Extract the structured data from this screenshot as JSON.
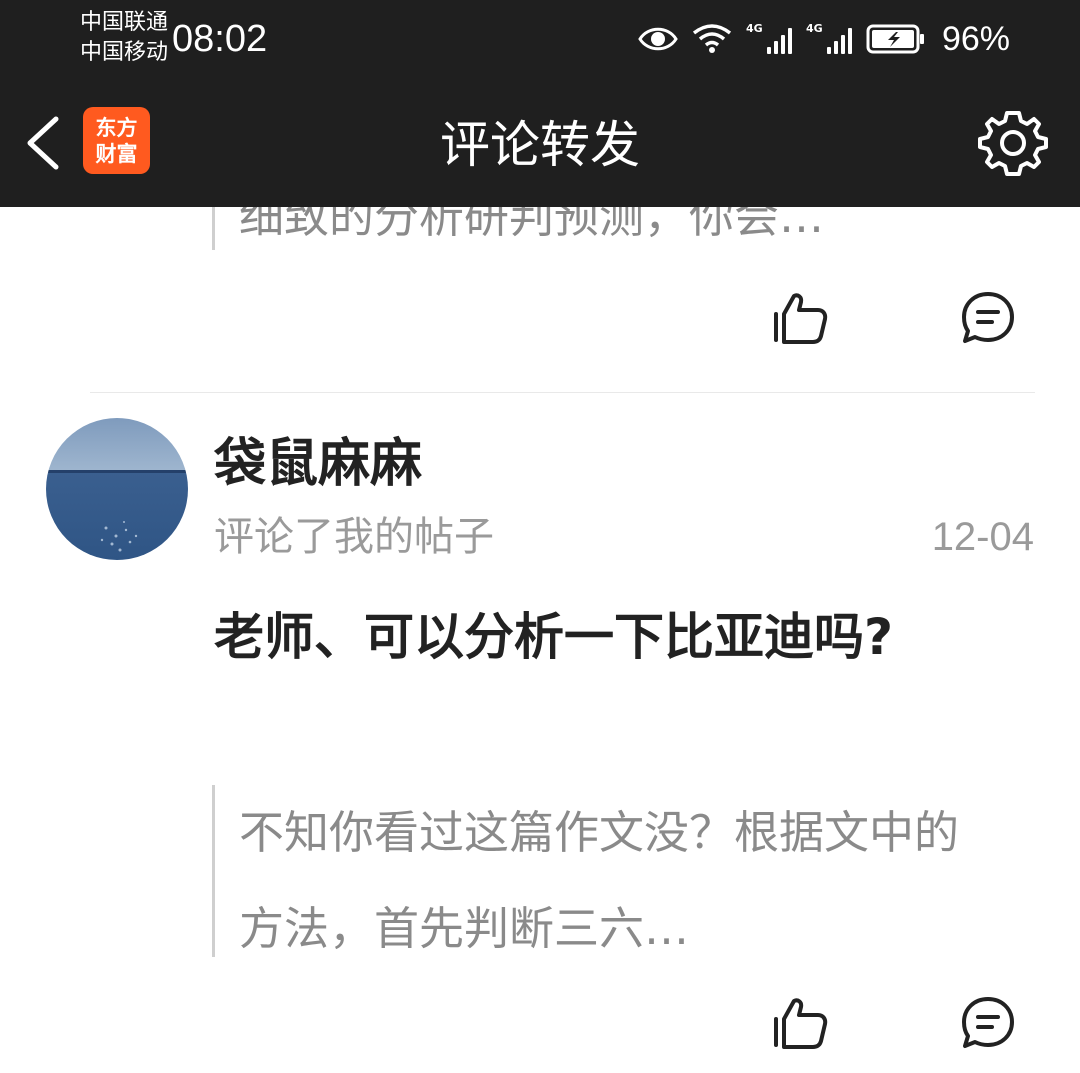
{
  "status_bar": {
    "carrier_1": "中国联通",
    "carrier_2": "中国移动",
    "time": "08:02",
    "signal_1_label": "4G",
    "signal_2_label": "4G",
    "battery": "96%",
    "icons": [
      "eye-icon",
      "wifi-icon",
      "signal-icon",
      "signal-icon",
      "battery-charging-icon"
    ]
  },
  "nav": {
    "title": "评论转发",
    "logo_line_1": "东方",
    "logo_line_2": "财富",
    "logo_color": "#ff5a1f",
    "icons": [
      "back-chevron-icon",
      "gear-icon"
    ]
  },
  "feed": {
    "previous_item": {
      "quote": "细致的分析研判预测，你会…"
    },
    "item": {
      "username": "袋鼠麻麻",
      "subtitle": "评论了我的帖子",
      "date": "12-04",
      "comment": "老师、可以分析一下比亚迪吗?",
      "quote": "不知你看过这篇作文没？根据文中的方法，首先判断三六…"
    },
    "action_icons": [
      "thumbs-up-icon",
      "comment-bubble-icon"
    ]
  }
}
